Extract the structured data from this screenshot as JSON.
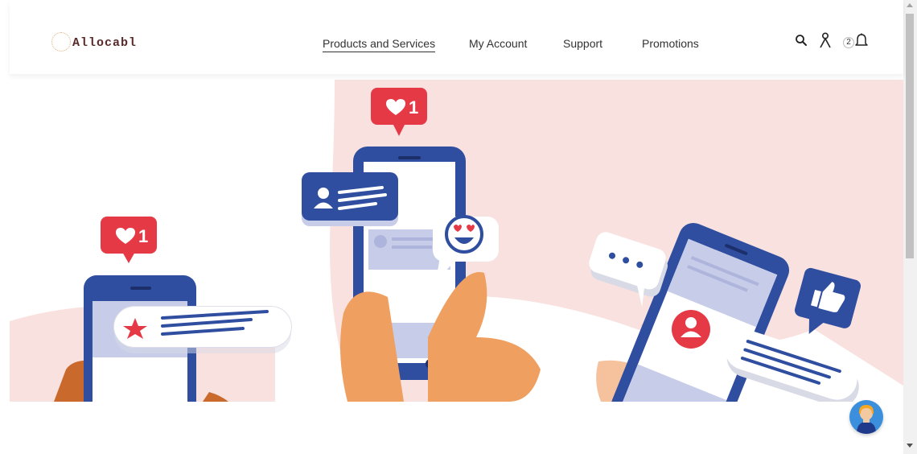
{
  "brand": {
    "name": "Allocabl"
  },
  "nav": {
    "items": [
      {
        "label": "Products and Services",
        "active": true
      },
      {
        "label": "My Account",
        "active": false
      },
      {
        "label": "Support",
        "active": false
      },
      {
        "label": "Promotions",
        "active": false
      }
    ]
  },
  "header_icons": {
    "search": "search-icon",
    "account": "user-icon",
    "notifications": "bell-icon",
    "notification_count": "2"
  },
  "hero": {
    "illustration": "social-media-phones-illustration",
    "like_count_left": "1",
    "like_count_center": "1"
  },
  "support": {
    "icon": "support-agent-icon"
  },
  "colors": {
    "hero_bg": "#f8e1df",
    "phone_blue": "#2f4ea0",
    "like_red": "#e63946",
    "hand": "#ef9f5f",
    "chat_button": "#3b8fdc"
  }
}
